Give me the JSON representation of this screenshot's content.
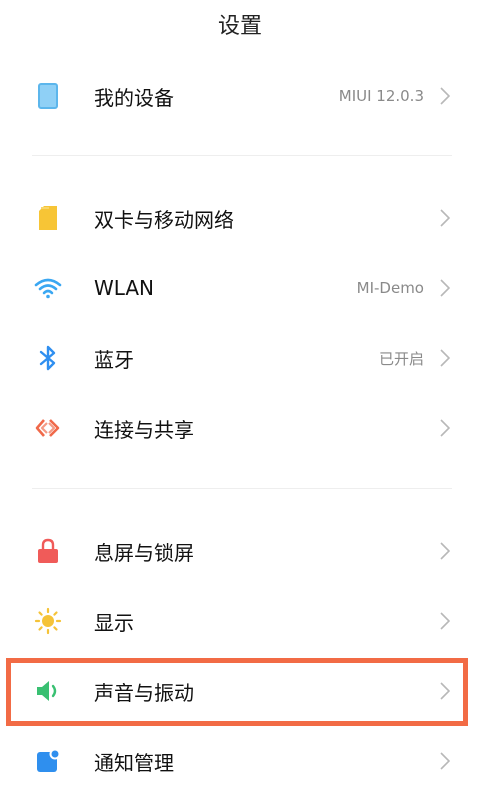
{
  "header": {
    "title": "设置"
  },
  "items": [
    {
      "label": "我的设备",
      "value": "MIUI 12.0.3",
      "icon": "device-icon"
    },
    {
      "label": "双卡与移动网络",
      "value": "",
      "icon": "sim-card-icon"
    },
    {
      "label": "WLAN",
      "value": "MI-Demo",
      "icon": "wifi-icon"
    },
    {
      "label": "蓝牙",
      "value": "已开启",
      "icon": "bluetooth-icon"
    },
    {
      "label": "连接与共享",
      "value": "",
      "icon": "connection-share-icon"
    },
    {
      "label": "息屏与锁屏",
      "value": "",
      "icon": "lock-icon"
    },
    {
      "label": "显示",
      "value": "",
      "icon": "sun-icon"
    },
    {
      "label": "声音与振动",
      "value": "",
      "icon": "speaker-icon"
    },
    {
      "label": "通知管理",
      "value": "",
      "icon": "notification-icon"
    }
  ],
  "colors": {
    "device": "#6ec3f3",
    "sim": "#f7c536",
    "wifi": "#3aa7f2",
    "bluetooth": "#2f8ff0",
    "connection": "#f0694a",
    "lock": "#f05b59",
    "sun": "#f5c338",
    "speaker": "#39c072",
    "notification": "#2f8fee",
    "highlight": "#f26b45"
  }
}
